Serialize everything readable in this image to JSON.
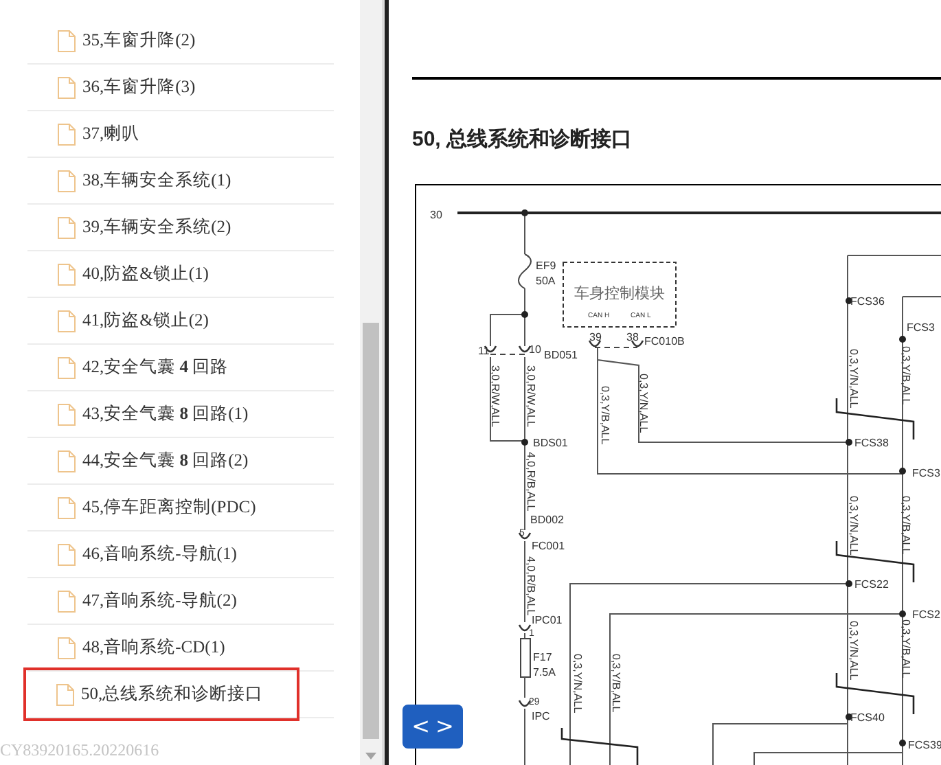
{
  "sidebar": {
    "items": [
      {
        "label": "35,车窗升降(2)",
        "selected": false
      },
      {
        "label": "36,车窗升降(3)",
        "selected": false
      },
      {
        "label": "37,喇叭",
        "selected": false
      },
      {
        "label": "38,车辆安全系统(1)",
        "selected": false
      },
      {
        "label": "39,车辆安全系统(2)",
        "selected": false
      },
      {
        "label": "40,防盗&锁止(1)",
        "selected": false
      },
      {
        "label": "41,防盗&锁止(2)",
        "selected": false
      },
      {
        "label": "42,安全气囊 **4** 回路",
        "selected": false
      },
      {
        "label": "43,安全气囊 **8** 回路(1)",
        "selected": false
      },
      {
        "label": "44,安全气囊 **8** 回路(2)",
        "selected": false
      },
      {
        "label": "45,停车距离控制(PDC)",
        "selected": false
      },
      {
        "label": "46,音响系统-导航(1)",
        "selected": false
      },
      {
        "label": "47,音响系统-导航(2)",
        "selected": false
      },
      {
        "label": "48,音响系统-CD(1)",
        "selected": false
      },
      {
        "label": "50,总线系统和诊断接口",
        "selected": true
      }
    ],
    "footer": "CY83920165.20220616"
  },
  "document": {
    "title": "50, 总线系统和诊断接口",
    "diagram_labels": [
      "30",
      "EF9",
      "50A",
      "车身控制模块",
      "CAN H",
      "CAN L",
      "39",
      "38",
      "FC010B",
      "11",
      "10",
      "BD051",
      "3,0,R/W,ALL",
      "3,0,R/W,ALL",
      "0,3,Y/B,ALL",
      "0,3,Y/N,ALL",
      "FCS36",
      "FCS3",
      "0,3,Y/N,ALL",
      "0,3,Y/B,ALL",
      "BDS01",
      "FCS38",
      "4,0,R/B,ALL",
      "FCS3",
      "0,3,Y/N,ALL",
      "0,3,Y/B,ALL",
      "BD002",
      "5",
      "FC001",
      "4,0,R/B,ALL",
      "FCS22",
      "FCS2",
      "IPC01",
      "1",
      "0,3,Y/N,ALL",
      "0,3,Y/B,ALL",
      "F17",
      "7.5A",
      "0,3,Y/N,ALL",
      "0,3,Y/B,ALL",
      "29",
      "IPC",
      "FCS40",
      "FCS39"
    ]
  },
  "nav": {
    "prev": "<",
    "next": ">"
  }
}
